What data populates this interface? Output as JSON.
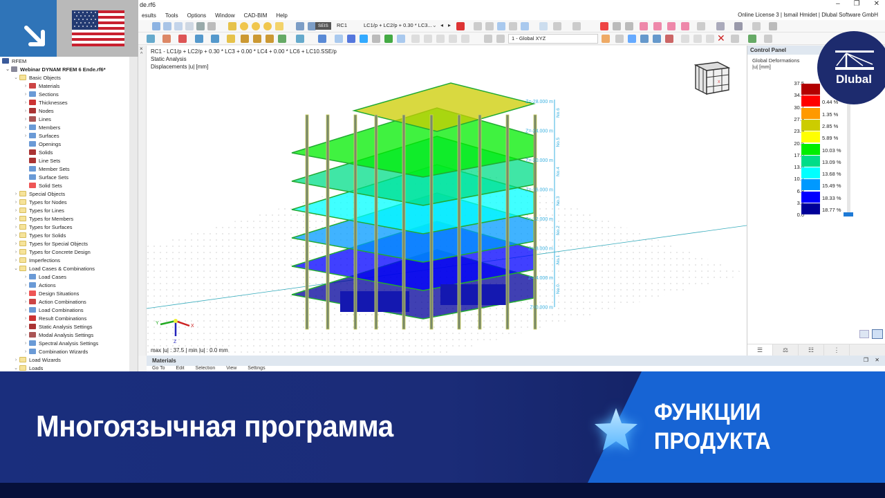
{
  "window": {
    "title_fragment": "de.rf6",
    "controls": [
      "–",
      "❐",
      "✕"
    ],
    "license": "Online License 3 | Ismail Hmidet | Dlubal Software GmbH"
  },
  "menu": [
    "esults",
    "Tools",
    "Options",
    "Window",
    "CAD-BIM",
    "Help"
  ],
  "toolbar": {
    "seis_badge": "SEIS",
    "load_case": "RC1",
    "combination": "LC1/p + LC2/p + 0.30 * LC3...",
    "coord_system": "1 - Global XYZ"
  },
  "navigator": {
    "root": "RFEM",
    "project": "Webinar DYNAM RFEM 6 Ende.rf6*",
    "items": [
      {
        "label": "Basic Objects",
        "level": 1,
        "folder": true,
        "expanded": true
      },
      {
        "label": "Materials",
        "level": 2,
        "chev": true
      },
      {
        "label": "Sections",
        "level": 2,
        "chev": true
      },
      {
        "label": "Thicknesses",
        "level": 2,
        "chev": true
      },
      {
        "label": "Nodes",
        "level": 2,
        "chev": true
      },
      {
        "label": "Lines",
        "level": 2,
        "chev": true
      },
      {
        "label": "Members",
        "level": 2,
        "chev": true
      },
      {
        "label": "Surfaces",
        "level": 2,
        "chev": true
      },
      {
        "label": "Openings",
        "level": 2
      },
      {
        "label": "Solids",
        "level": 2
      },
      {
        "label": "Line Sets",
        "level": 2
      },
      {
        "label": "Member Sets",
        "level": 2
      },
      {
        "label": "Surface Sets",
        "level": 2
      },
      {
        "label": "Solid Sets",
        "level": 2
      },
      {
        "label": "Special Objects",
        "level": 1,
        "folder": true
      },
      {
        "label": "Types for Nodes",
        "level": 1,
        "folder": true
      },
      {
        "label": "Types for Lines",
        "level": 1,
        "folder": true
      },
      {
        "label": "Types for Members",
        "level": 1,
        "folder": true
      },
      {
        "label": "Types for Surfaces",
        "level": 1,
        "folder": true
      },
      {
        "label": "Types for Solids",
        "level": 1,
        "folder": true
      },
      {
        "label": "Types for Special Objects",
        "level": 1,
        "folder": true
      },
      {
        "label": "Types for Concrete Design",
        "level": 1,
        "folder": true
      },
      {
        "label": "Imperfections",
        "level": 1,
        "folder": true
      },
      {
        "label": "Load Cases & Combinations",
        "level": 1,
        "folder": true,
        "expanded": true
      },
      {
        "label": "Load Cases",
        "level": 2,
        "chev": true
      },
      {
        "label": "Actions",
        "level": 2,
        "chev": true
      },
      {
        "label": "Design Situations",
        "level": 2,
        "chev": true
      },
      {
        "label": "Action Combinations",
        "level": 2,
        "chev": true
      },
      {
        "label": "Load Combinations",
        "level": 2,
        "chev": true
      },
      {
        "label": "Result Combinations",
        "level": 2,
        "chev": true
      },
      {
        "label": "Static Analysis Settings",
        "level": 2,
        "chev": true
      },
      {
        "label": "Modal Analysis Settings",
        "level": 2,
        "chev": true
      },
      {
        "label": "Spectral Analysis Settings",
        "level": 2,
        "chev": true
      },
      {
        "label": "Combination Wizards",
        "level": 2,
        "chev": true
      },
      {
        "label": "Load Wizards",
        "level": 1,
        "folder": true
      },
      {
        "label": "Loads",
        "level": 1,
        "folder": true,
        "expanded": true
      }
    ]
  },
  "viewport": {
    "info_line1": "RC1 - LC1/p + LC2/p + 0.30 * LC3 + 0.00 * LC4 + 0.00 * LC6 + LC10.SSE/p",
    "info_line2": "Static Analysis",
    "info_line3": "Displacements |u| [mm]",
    "footer": "max |u| : 37.5 | min |u| : 0.0 mm",
    "axes": {
      "x": "X",
      "y": "Y",
      "z": "Z"
    },
    "levels": [
      {
        "z": "Z=-28.000 m",
        "story": "No.6"
      },
      {
        "z": "Z=-24.000 m",
        "story": "No.5"
      },
      {
        "z": "Z=-20.000 m",
        "story": "No.4"
      },
      {
        "z": "Z=-16.000 m",
        "story": "No.3"
      },
      {
        "z": "Z=-12.000 m",
        "story": "No.2"
      },
      {
        "z": "Z=-8.000 m",
        "story": "No.1"
      },
      {
        "z": "Z=-4.000 m",
        "story": "No.0"
      },
      {
        "z": "Z=0.000 m",
        "story": ""
      }
    ]
  },
  "control_panel": {
    "header": "Control Panel",
    "title": "Global Deformations",
    "unit": "|u| [mm]",
    "legend_values": [
      "37.5",
      "34.1",
      "30.7",
      "27.3",
      "23.9",
      "20.5",
      "17.0",
      "13.6",
      "10.2",
      "6.8",
      "3.4",
      "0.0"
    ],
    "legend_colors": [
      "#b30000",
      "#ff0000",
      "#ff9900",
      "#cccc00",
      "#ffff00",
      "#00ee00",
      "#00dd88",
      "#00ffff",
      "#0099ff",
      "#0000ff",
      "#000099"
    ],
    "legend_percent": [
      "",
      "0.44 %",
      "1.35 %",
      "2.85 %",
      "5.89 %",
      "10.03 %",
      "13.09 %",
      "13.68 %",
      "15.49 %",
      "18.33 %",
      "18.77 %"
    ],
    "tabs": [
      "legend",
      "balance",
      "list",
      "members"
    ]
  },
  "materials_panel": {
    "title": "Materials",
    "menu": [
      "Go To",
      "Edit",
      "Selection",
      "View",
      "Settings"
    ]
  },
  "logo": {
    "text": "Dlubal"
  },
  "banner": {
    "title": "Многоязычная программа",
    "subtitle_line1": "ФУНКЦИИ",
    "subtitle_line2": "ПРОДУКТА"
  },
  "colors": {
    "banner_dark": "#1a2e7d",
    "banner_accent": "#1764d4",
    "arrow_box": "#2f74b8",
    "logo_bg": "#1d2b6e"
  }
}
